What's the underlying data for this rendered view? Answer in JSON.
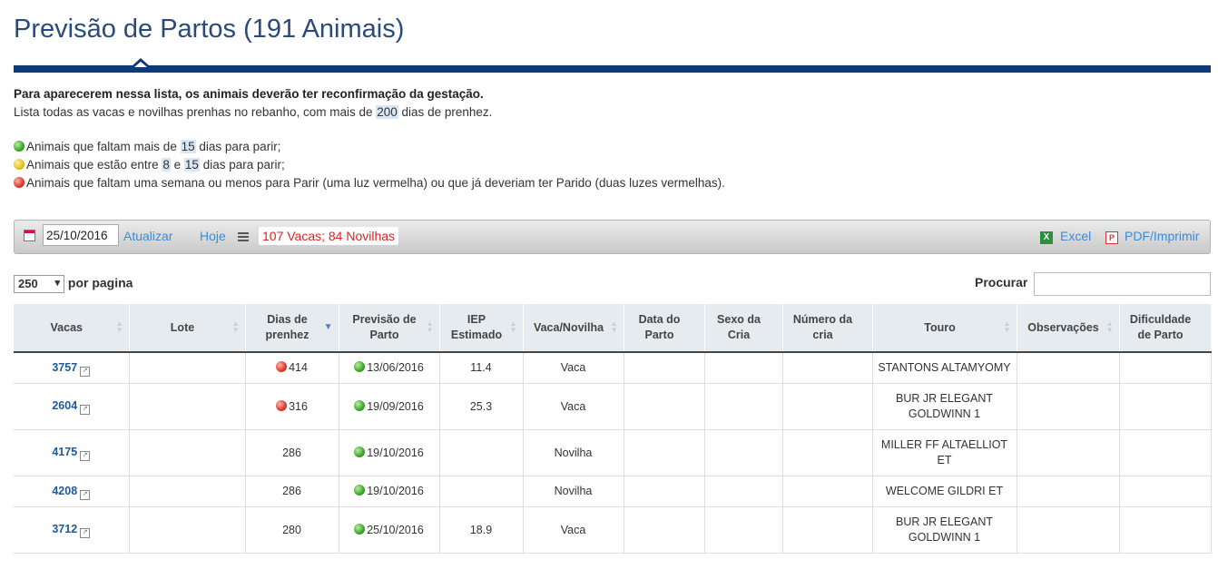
{
  "page": {
    "title": "Previsão de Partos (191 Animais)",
    "intro_bold": "Para aparecerem nessa lista, os animais deverão ter reconfirmação da gestação.",
    "intro_line_pre": "Lista todas as vacas e novilhas prenhas no rebanho, com mais de",
    "intro_days": "200",
    "intro_line_post": "dias de prenhez."
  },
  "legend": {
    "green_pre": "Animais que faltam mais de",
    "green_days": "15",
    "green_post": "dias para parir;",
    "yellow_pre": "Animais que estão entre",
    "yellow_a": "8",
    "yellow_mid": "e",
    "yellow_b": "15",
    "yellow_post": "dias para parir;",
    "red_text": "Animais que faltam uma semana ou menos para Parir (uma luz vermelha) ou que já deveriam ter Parido (duas luzes vermelhas)."
  },
  "toolbar": {
    "date_value": "25/10/2016",
    "update_label": "Atualizar",
    "today_label": "Hoje",
    "count_badge": "107 Vacas; 84 Novilhas",
    "excel_label": "Excel",
    "pdf_label": "PDF/Imprimir"
  },
  "pagination": {
    "per_page_value": "250",
    "per_page_label": "por pagina"
  },
  "search": {
    "label": "Procurar"
  },
  "table": {
    "headers": [
      "Vacas",
      "Lote",
      "Dias de prenhez",
      "Previsão de Parto",
      "IEP Estimado",
      "Vaca/Novilha",
      "Data do Parto",
      "Sexo da Cria",
      "Número da cria",
      "Touro",
      "Observações",
      "Dificuldade de Parto"
    ],
    "rows": [
      {
        "vaca": "3757",
        "lote": "",
        "dias": "414",
        "dias_status": "red",
        "previsao": "13/06/2016",
        "previsao_status": "green",
        "iep": "11.4",
        "tipo": "Vaca",
        "data_parto": "",
        "sexo": "",
        "numero": "",
        "touro": "STANTONS ALTAMYOMY",
        "obs": "",
        "dificuldade": ""
      },
      {
        "vaca": "2604",
        "lote": "",
        "dias": "316",
        "dias_status": "red",
        "previsao": "19/09/2016",
        "previsao_status": "green",
        "iep": "25.3",
        "tipo": "Vaca",
        "data_parto": "",
        "sexo": "",
        "numero": "",
        "touro": "BUR JR ELEGANT GOLDWINN 1",
        "obs": "",
        "dificuldade": ""
      },
      {
        "vaca": "4175",
        "lote": "",
        "dias": "286",
        "dias_status": "",
        "previsao": "19/10/2016",
        "previsao_status": "green",
        "iep": "",
        "tipo": "Novilha",
        "data_parto": "",
        "sexo": "",
        "numero": "",
        "touro": "MILLER FF ALTAELLIOT ET",
        "obs": "",
        "dificuldade": ""
      },
      {
        "vaca": "4208",
        "lote": "",
        "dias": "286",
        "dias_status": "",
        "previsao": "19/10/2016",
        "previsao_status": "green",
        "iep": "",
        "tipo": "Novilha",
        "data_parto": "",
        "sexo": "",
        "numero": "",
        "touro": "WELCOME GILDRI ET",
        "obs": "",
        "dificuldade": ""
      },
      {
        "vaca": "3712",
        "lote": "",
        "dias": "280",
        "dias_status": "",
        "previsao": "25/10/2016",
        "previsao_status": "green",
        "iep": "18.9",
        "tipo": "Vaca",
        "data_parto": "",
        "sexo": "",
        "numero": "",
        "touro": "BUR JR ELEGANT GOLDWINN 1",
        "obs": "",
        "dificuldade": ""
      }
    ]
  }
}
